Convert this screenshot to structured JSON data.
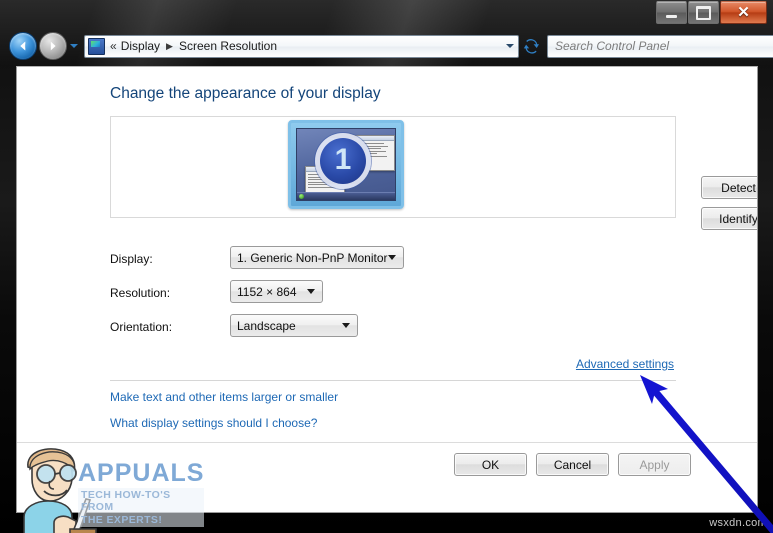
{
  "window": {
    "caption_buttons": {
      "minimize": "Minimize",
      "maximize": "Maximize",
      "close": "Close"
    }
  },
  "navbar": {
    "back_label": "Back",
    "forward_label": "Forward",
    "history_label": "Recent pages",
    "breadcrumb": {
      "icon": "display-control-panel-icon",
      "overflow": "«",
      "items": [
        {
          "label": "Display"
        },
        {
          "label": "Screen Resolution"
        }
      ],
      "separator": "▶",
      "dropdown_icon": "chevron-down-icon"
    },
    "refresh": {
      "icon": "refresh-icon",
      "label": "Refresh"
    },
    "search": {
      "placeholder": "Search Control Panel",
      "value": "",
      "icon": "search-icon"
    }
  },
  "main": {
    "heading": "Change the appearance of your display",
    "preview": {
      "monitor_number": "1",
      "detect_label": "Detect",
      "identify_label": "Identify"
    },
    "fields": [
      {
        "label": "Display:",
        "value": "1. Generic Non-PnP Monitor"
      },
      {
        "label": "Resolution:",
        "value": "1152 × 864"
      },
      {
        "label": "Orientation:",
        "value": "Landscape"
      }
    ],
    "advanced_settings_link": "Advanced settings",
    "help_links": [
      "Make text and other items larger or smaller",
      "What display settings should I choose?"
    ],
    "footer_buttons": {
      "ok": "OK",
      "cancel": "Cancel",
      "apply": "Apply"
    }
  },
  "watermark": {
    "title": "APPUALS",
    "subtitle_line1": "TECH HOW-TO'S FROM",
    "subtitle_line2": "THE EXPERTS!"
  },
  "site_tag": "wsxdn.com",
  "annotation": {
    "type": "arrow",
    "color": "#1414d2",
    "points_to": "Advanced settings"
  },
  "colors": {
    "heading_blue": "#14457a",
    "link_blue": "#1e69b5",
    "arrow_blue": "#1414d2",
    "accent_orange": "#d1562a"
  }
}
